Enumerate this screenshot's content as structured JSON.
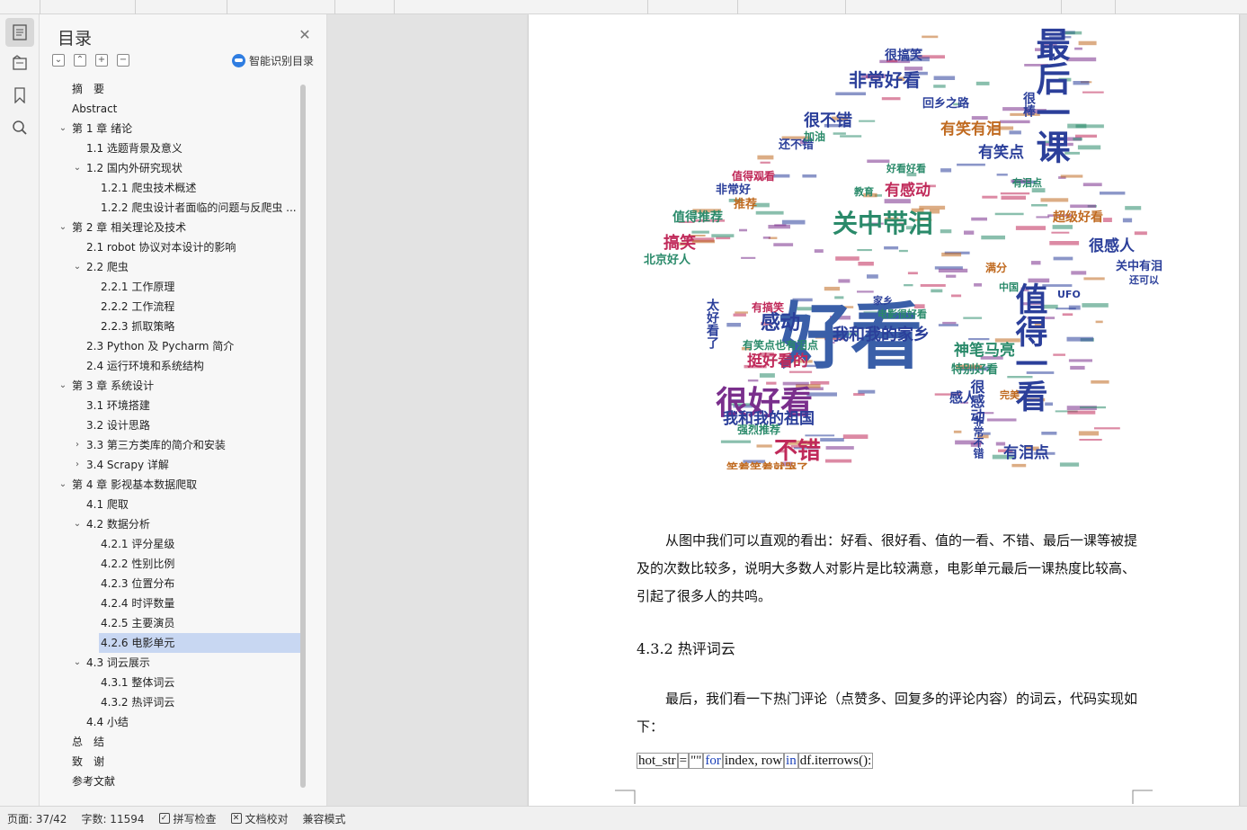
{
  "toc": {
    "title": "目录",
    "smart_label": "智能识别目录",
    "items": [
      {
        "label": "摘　要",
        "level": 1,
        "caret": ""
      },
      {
        "label": "Abstract",
        "level": 1,
        "caret": ""
      },
      {
        "label": "第 1 章  绪论",
        "level": 1,
        "caret": "open"
      },
      {
        "label": "1.1  选题背景及意义",
        "level": 2,
        "caret": ""
      },
      {
        "label": "1.2  国内外研究现状",
        "level": 2,
        "caret": "open"
      },
      {
        "label": "1.2.1   爬虫技术概述",
        "level": 3,
        "caret": ""
      },
      {
        "label": "1.2.2   爬虫设计者面临的问题与反爬虫 ...",
        "level": 3,
        "caret": ""
      },
      {
        "label": "第 2 章  相关理论及技术",
        "level": 1,
        "caret": "open"
      },
      {
        "label": "2.1 robot 协议对本设计的影响",
        "level": 2,
        "caret": ""
      },
      {
        "label": "2.2  爬虫",
        "level": 2,
        "caret": "open"
      },
      {
        "label": "2.2.1   工作原理",
        "level": 3,
        "caret": ""
      },
      {
        "label": "2.2.2   工作流程",
        "level": 3,
        "caret": ""
      },
      {
        "label": "2.2.3   抓取策略",
        "level": 3,
        "caret": ""
      },
      {
        "label": "2.3 Python 及 Pycharm 简介",
        "level": 2,
        "caret": ""
      },
      {
        "label": "2.4 运行环境和系统结构",
        "level": 2,
        "caret": ""
      },
      {
        "label": "第 3 章  系统设计",
        "level": 1,
        "caret": "open"
      },
      {
        "label": "3.1 环境搭建",
        "level": 2,
        "caret": ""
      },
      {
        "label": "3.2 设计思路",
        "level": 2,
        "caret": ""
      },
      {
        "label": "3.3  第三方类库的简介和安装",
        "level": 2,
        "caret": "closed"
      },
      {
        "label": "3.4 Scrapy 详解",
        "level": 2,
        "caret": "closed"
      },
      {
        "label": "第 4 章  影视基本数据爬取",
        "level": 1,
        "caret": "open"
      },
      {
        "label": "4.1 爬取",
        "level": 2,
        "caret": ""
      },
      {
        "label": "4.2 数据分析",
        "level": 2,
        "caret": "open"
      },
      {
        "label": "4.2.1 评分星级",
        "level": 3,
        "caret": ""
      },
      {
        "label": "4.2.2 性别比例",
        "level": 3,
        "caret": ""
      },
      {
        "label": "4.2.3 位置分布",
        "level": 3,
        "caret": ""
      },
      {
        "label": "4.2.4 时评数量",
        "level": 3,
        "caret": ""
      },
      {
        "label": "4.2.5 主要演员",
        "level": 3,
        "caret": ""
      },
      {
        "label": "4.2.6 电影单元",
        "level": 3,
        "caret": "",
        "selected": true
      },
      {
        "label": "4.3 词云展示",
        "level": 2,
        "caret": "open"
      },
      {
        "label": "4.3.1 整体词云",
        "level": 3,
        "caret": ""
      },
      {
        "label": "4.3.2 热评词云",
        "level": 3,
        "caret": ""
      },
      {
        "label": "4.4 小结",
        "level": 2,
        "caret": ""
      },
      {
        "label": "总　结",
        "level": 1,
        "caret": ""
      },
      {
        "label": "致　谢",
        "level": 1,
        "caret": ""
      },
      {
        "label": "参考文献",
        "level": 1,
        "caret": ""
      }
    ]
  },
  "document": {
    "paragraph1": "从图中我们可以直观的看出：好看、很好看、值的一看、不错、最后一课等被提及的次数比较多，说明大多数人对影片是比较满意，电影单元最后一课热度比较高、引起了很多人的共鸣。",
    "heading": "4.3.2 热评词云",
    "paragraph2": "最后，我们看一下热门评论（点赞多、回复多的评论内容）的词云，代码实现如下：",
    "code": {
      "p1": "hot_str",
      "p2": "=",
      "p3": "\"\"",
      "p4": "for",
      "p5": "index, row",
      "p6": "in",
      "p7": "df.iterrows():"
    },
    "wordcloud": [
      {
        "t": "好看",
        "c": "#3a5fa8"
      },
      {
        "t": "最后一课",
        "c": "#2b3f9a"
      },
      {
        "t": "值得一看",
        "c": "#2b3f9a"
      },
      {
        "t": "很好看",
        "c": "#7a2f8c"
      },
      {
        "t": "关中带泪",
        "c": "#2a8a6a"
      },
      {
        "t": "非常好看",
        "c": "#2b3f9a"
      },
      {
        "t": "感动",
        "c": "#2b3f9a"
      },
      {
        "t": "我和我的家乡",
        "c": "#2b3f9a"
      },
      {
        "t": "不错",
        "c": "#c02a5a"
      },
      {
        "t": "我和我的祖国",
        "c": "#2b3f9a"
      },
      {
        "t": "挺好看的",
        "c": "#c02a5a"
      },
      {
        "t": "神笔马亮",
        "c": "#2a8a6a"
      },
      {
        "t": "有笑有泪",
        "c": "#c06a20"
      },
      {
        "t": "很不错",
        "c": "#2b3f9a"
      },
      {
        "t": "有感动",
        "c": "#c02a5a"
      },
      {
        "t": "有笑点",
        "c": "#2b3f9a"
      },
      {
        "t": "很感人",
        "c": "#2b3f9a"
      },
      {
        "t": "有泪点",
        "c": "#2b3f9a"
      },
      {
        "t": "搞笑",
        "c": "#c02a5a"
      },
      {
        "t": "很搞笑",
        "c": "#2b3f9a"
      },
      {
        "t": "值得推荐",
        "c": "#2a8a6a"
      },
      {
        "t": "超级好看",
        "c": "#c06a20"
      },
      {
        "t": "回乡之路",
        "c": "#2b3f9a"
      },
      {
        "t": "关中有泪",
        "c": "#2b3f9a"
      },
      {
        "t": "北京好人",
        "c": "#2a8a6a"
      },
      {
        "t": "笑着笑着就哭了",
        "c": "#c06a20"
      },
      {
        "t": "很感动",
        "c": "#2b3f9a"
      },
      {
        "t": "特别好看",
        "c": "#2a8a6a"
      },
      {
        "t": "太好看了",
        "c": "#2b3f9a"
      },
      {
        "t": "推荐",
        "c": "#c06a20"
      },
      {
        "t": "感人",
        "c": "#2b3f9a"
      },
      {
        "t": "很棒",
        "c": "#2b3f9a"
      },
      {
        "t": "有笑点也有泪点",
        "c": "#2a8a6a"
      },
      {
        "t": "非常好",
        "c": "#2b3f9a"
      },
      {
        "t": "还不错",
        "c": "#2b3f9a"
      },
      {
        "t": "加油",
        "c": "#2a8a6a"
      },
      {
        "t": "好看好看",
        "c": "#2a8a6a"
      },
      {
        "t": "UFO",
        "c": "#2b3f9a"
      },
      {
        "t": "电影很好看",
        "c": "#2a8a6a"
      },
      {
        "t": "有泪点",
        "c": "#2a8a6a"
      },
      {
        "t": "满分",
        "c": "#c06a20"
      },
      {
        "t": "家乡",
        "c": "#2b3f9a"
      },
      {
        "t": "强烈推荐",
        "c": "#2a8a6a"
      },
      {
        "t": "值得观看",
        "c": "#c02a5a"
      },
      {
        "t": "教育",
        "c": "#2a8a6a"
      },
      {
        "t": "非常不错",
        "c": "#2b3f9a"
      },
      {
        "t": "完美",
        "c": "#c06a20"
      },
      {
        "t": "有搞笑",
        "c": "#c02a5a"
      },
      {
        "t": "中国",
        "c": "#2a8a6a"
      },
      {
        "t": "还可以",
        "c": "#2b3f9a"
      }
    ]
  },
  "status": {
    "page": "页面: 37/42",
    "words": "字数: 11594",
    "spell": "拼写检查",
    "proof": "文档校对",
    "compat": "兼容模式"
  }
}
